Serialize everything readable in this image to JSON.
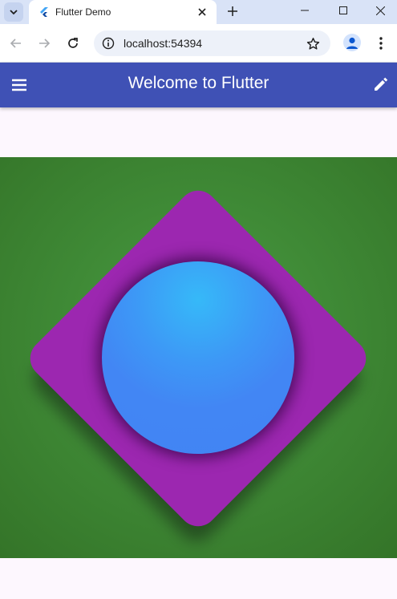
{
  "browser": {
    "tab": {
      "title": "Flutter Demo",
      "favicon": "flutter-logo-icon"
    },
    "address_bar": {
      "url": "localhost:54394"
    },
    "icons": [
      "tab-search-icon",
      "close-icon",
      "plus-icon",
      "minimize-icon",
      "maximize-icon",
      "close-window-icon",
      "back-arrow-icon",
      "forward-arrow-icon",
      "reload-icon",
      "site-info-icon",
      "star-icon",
      "profile-icon",
      "more-vert-icon"
    ]
  },
  "app": {
    "appbar": {
      "title": "Welcome to Flutter",
      "background": "#3f51b5",
      "leading_icon": "menu-icon",
      "action_icon": "edit-icon"
    },
    "scaffold_background": "#fdf7fe",
    "stage": {
      "background": "#43903a",
      "diamond_color": "#9c27b0",
      "circle_colors": [
        "#36b9f8",
        "#4184f3"
      ]
    }
  }
}
